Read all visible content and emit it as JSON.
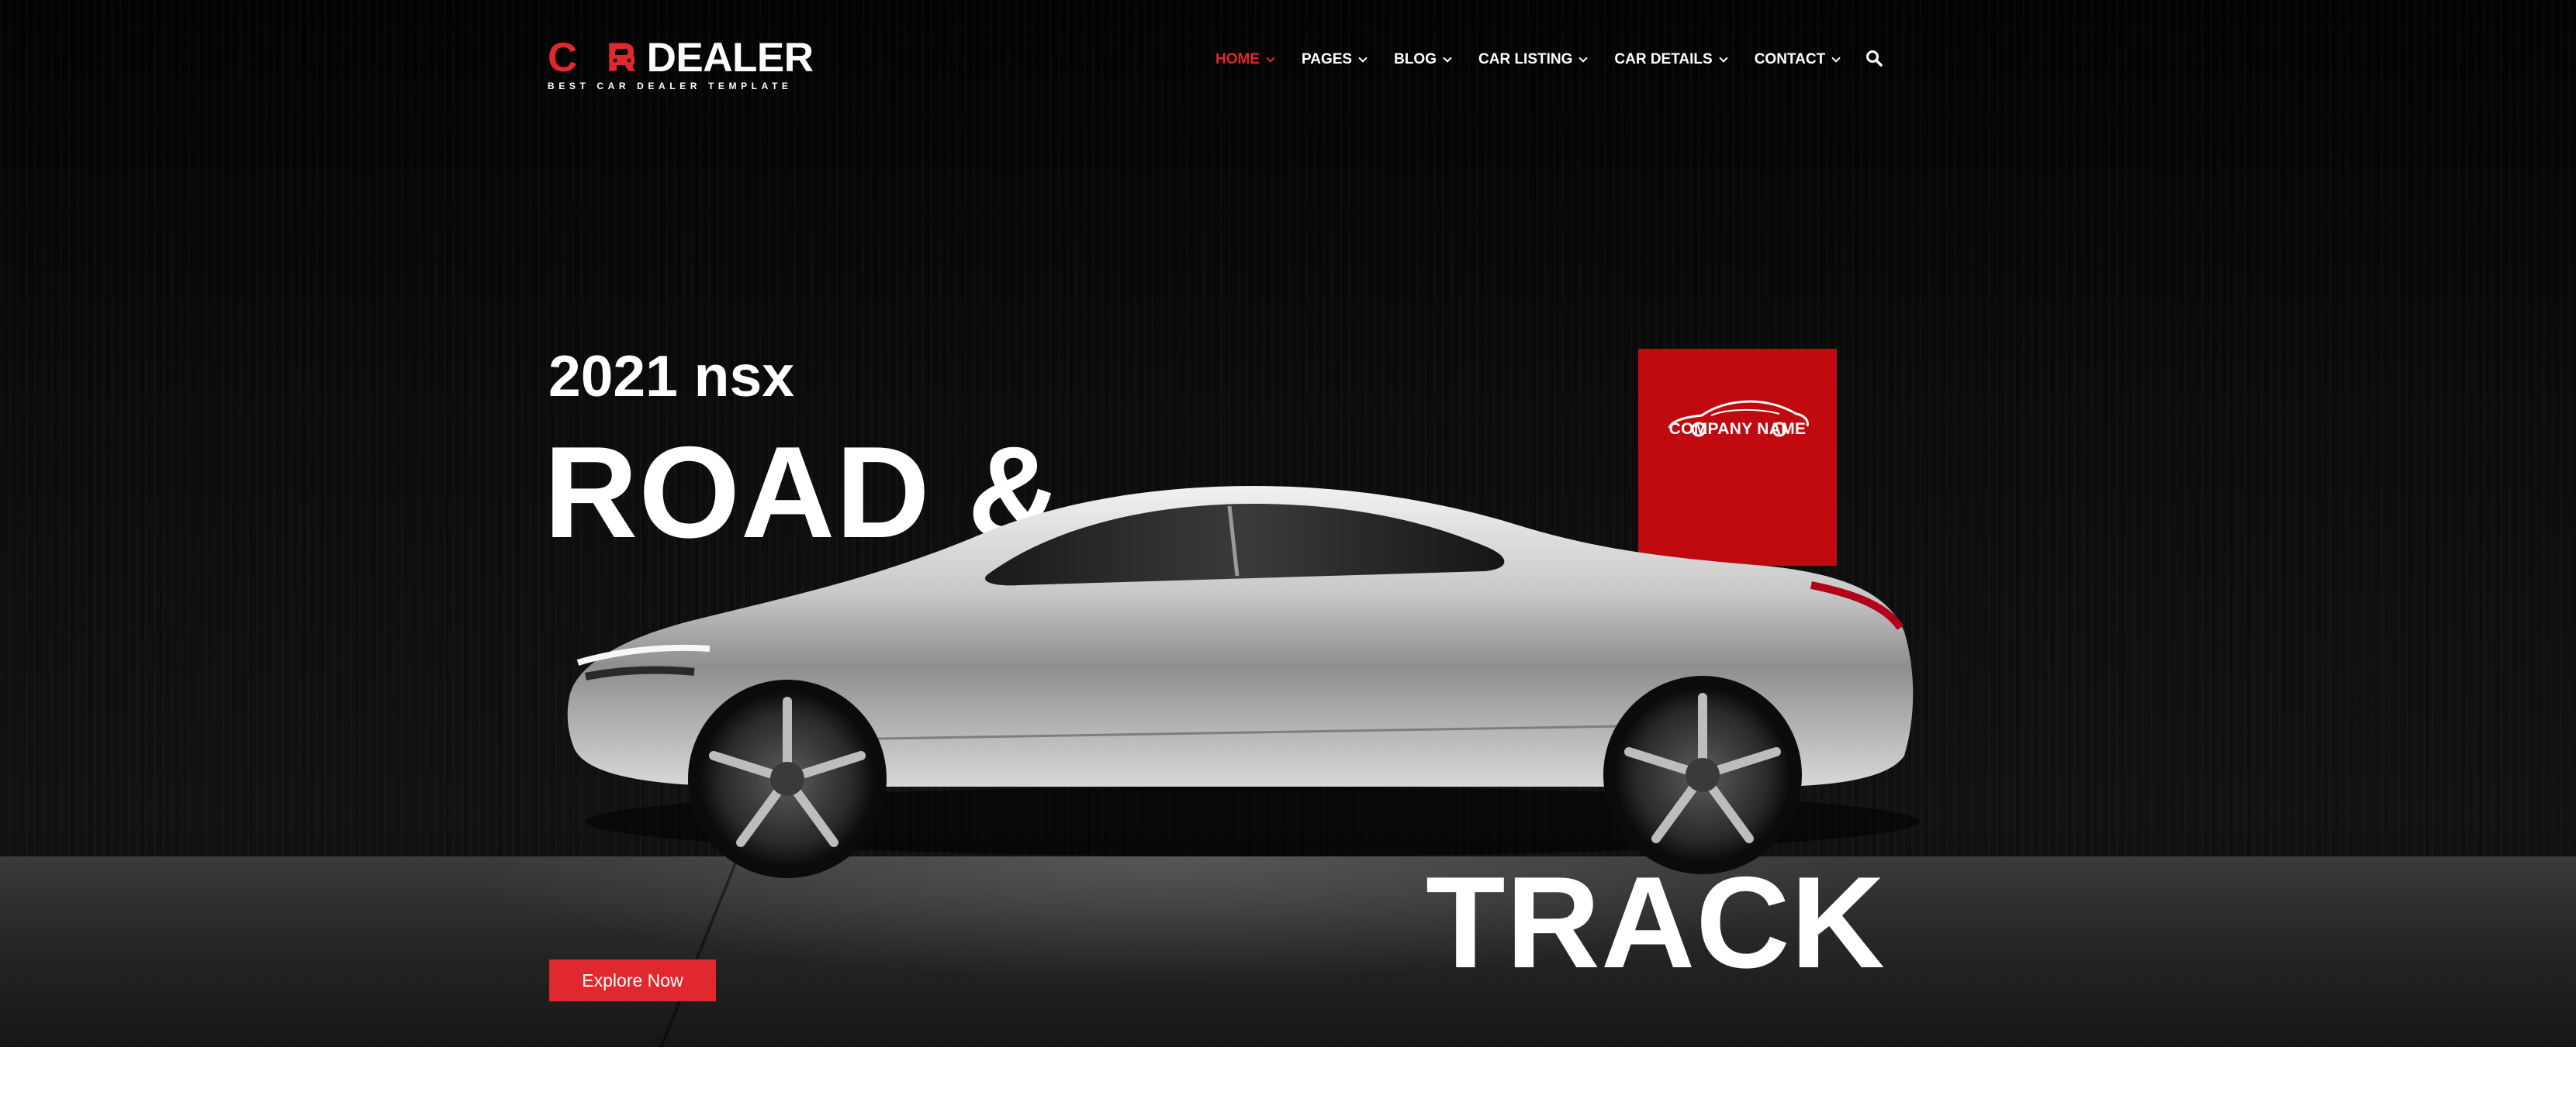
{
  "logo": {
    "part_red_1": "C",
    "part_red_2": "R",
    "part_white": "DEALER",
    "tagline": "BEST CAR DEALER TEMPLATE",
    "icon": "car-front-icon"
  },
  "nav": {
    "items": [
      {
        "label": "HOME",
        "active": true
      },
      {
        "label": "PAGES",
        "active": false
      },
      {
        "label": "BLOG",
        "active": false
      },
      {
        "label": "CAR LISTING",
        "active": false
      },
      {
        "label": "CAR DETAILS",
        "active": false
      },
      {
        "label": "CONTACT",
        "active": false
      }
    ],
    "search_icon": "search-icon"
  },
  "hero": {
    "subtitle": "2021 nsx",
    "title_line_1": "ROAD &",
    "title_line_2": "TRACK",
    "brand_block": {
      "name": "COMPANY NAME",
      "icon": "sports-car-outline-icon"
    },
    "cta_label": "Explore Now"
  },
  "colors": {
    "accent": "#e0282e",
    "brand_block": "#c00a0f",
    "background": "#0a0a0a",
    "text": "#ffffff"
  }
}
